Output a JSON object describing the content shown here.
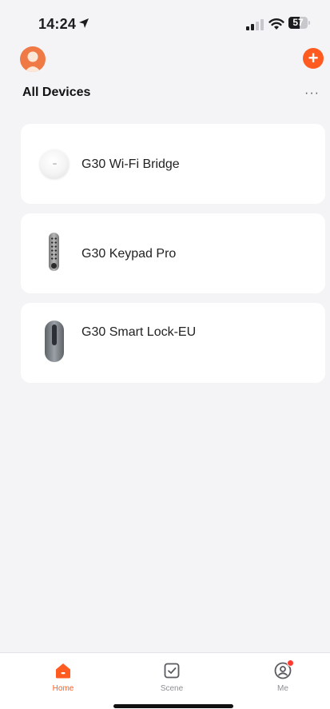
{
  "status_bar": {
    "time": "14:24",
    "battery_level": "57",
    "battery_fraction": 0.57,
    "signal_bars_active": 2,
    "signal_bars_total": 4
  },
  "header": {
    "add_label": "+",
    "more_label": "···"
  },
  "section": {
    "title": "All Devices"
  },
  "devices": [
    {
      "name": "G30 Wi-Fi Bridge",
      "icon": "wifi-bridge-icon"
    },
    {
      "name": "G30 Keypad Pro",
      "icon": "keypad-icon"
    },
    {
      "name": "G30 Smart Lock-EU",
      "icon": "smart-lock-icon"
    }
  ],
  "tabs": [
    {
      "label": "Home",
      "icon": "home-icon",
      "active": true
    },
    {
      "label": "Scene",
      "icon": "scene-checkbox-icon",
      "active": false
    },
    {
      "label": "Me",
      "icon": "profile-icon",
      "active": false,
      "badge": true
    }
  ],
  "colors": {
    "accent": "#ff5a1f",
    "avatar": "#f07a45",
    "badge": "#ff3b30",
    "background": "#f4f4f6"
  }
}
